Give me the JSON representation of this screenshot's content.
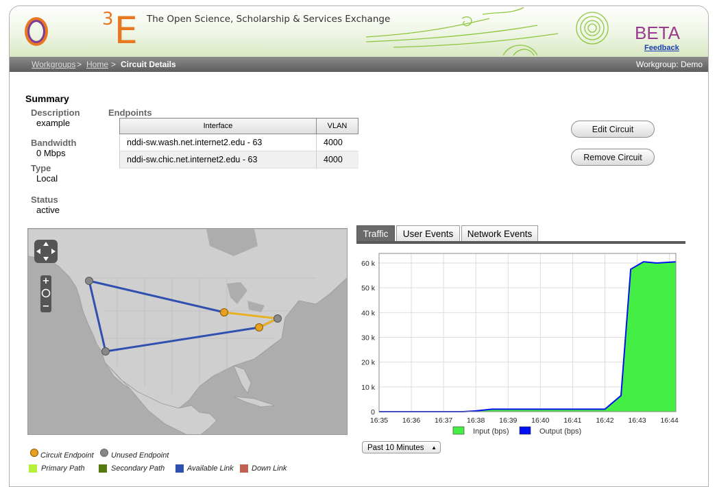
{
  "header": {
    "logo_text": "OS",
    "logo_tail": "E",
    "logo_sup": "3",
    "tagline": "The Open Science, Scholarship & Services Exchange",
    "beta": "BETA",
    "feedback": "Feedback"
  },
  "breadcrumb": {
    "items": [
      "Workgroups",
      "Home",
      "Circuit Details"
    ],
    "separator": ">",
    "workgroup": "Workgroup: Demo"
  },
  "summary": {
    "title": "Summary",
    "description_label": "Description",
    "description": "example",
    "bandwidth_label": "Bandwidth",
    "bandwidth": "0 Mbps",
    "type_label": "Type",
    "type": "Local",
    "status_label": "Status",
    "status": "active"
  },
  "endpoints": {
    "title": "Endpoints",
    "columns": [
      "Interface",
      "VLAN"
    ],
    "rows": [
      {
        "interface": "nddi-sw.wash.net.internet2.edu - 63",
        "vlan": "4000"
      },
      {
        "interface": "nddi-sw.chic.net.internet2.edu - 63",
        "vlan": "4000"
      }
    ]
  },
  "actions": {
    "edit": "Edit Circuit",
    "remove": "Remove Circuit"
  },
  "tabs": [
    "Traffic",
    "User Events",
    "Network Events"
  ],
  "chart_data": {
    "type": "area",
    "x": [
      "16:35",
      "16:36",
      "16:37",
      "16:38",
      "16:39",
      "16:40",
      "16:41",
      "16:42",
      "16:43",
      "16:44"
    ],
    "ylim": [
      0,
      60000
    ],
    "yticks": [
      "0",
      "10 k",
      "20 k",
      "30 k",
      "40 k",
      "50 k",
      "60 k"
    ],
    "series": [
      {
        "name": "Input (bps)",
        "color": "#44ee44",
        "points": [
          [
            0,
            0
          ],
          [
            1,
            0
          ],
          [
            2,
            0
          ],
          [
            2.6,
            0
          ],
          [
            3,
            0
          ],
          [
            3.5,
            900
          ],
          [
            4,
            900
          ],
          [
            5,
            900
          ],
          [
            6,
            900
          ],
          [
            7,
            900
          ],
          [
            7.5,
            6500
          ],
          [
            7.8,
            57500
          ],
          [
            8.2,
            60500
          ],
          [
            8.6,
            60000
          ],
          [
            9.2,
            60500
          ]
        ]
      },
      {
        "name": "Output (bps)",
        "color": "#0010ee",
        "points": [
          [
            0,
            0
          ],
          [
            1,
            0
          ],
          [
            2,
            0
          ],
          [
            2.6,
            0
          ],
          [
            3,
            300
          ],
          [
            3.5,
            1000
          ],
          [
            4,
            1000
          ],
          [
            5,
            1000
          ],
          [
            6,
            1000
          ],
          [
            7,
            1000
          ],
          [
            7.5,
            6500
          ],
          [
            7.8,
            57500
          ],
          [
            8.2,
            60500
          ],
          [
            8.6,
            60000
          ],
          [
            9.2,
            60500
          ]
        ]
      }
    ]
  },
  "range_select": "Past 10 Minutes",
  "legend": {
    "circuit_endpoint": "Circuit Endpoint",
    "unused_endpoint": "Unused Endpoint",
    "primary_path": "Primary Path",
    "secondary_path": "Secondary Path",
    "available_link": "Available Link",
    "down_link": "Down Link",
    "colors": {
      "circuit_endpoint": "#e8a020",
      "unused_endpoint": "#888888",
      "primary_path": "#b8f040",
      "secondary_path": "#557a10",
      "available_link": "#3050b0",
      "down_link": "#c06050"
    }
  }
}
